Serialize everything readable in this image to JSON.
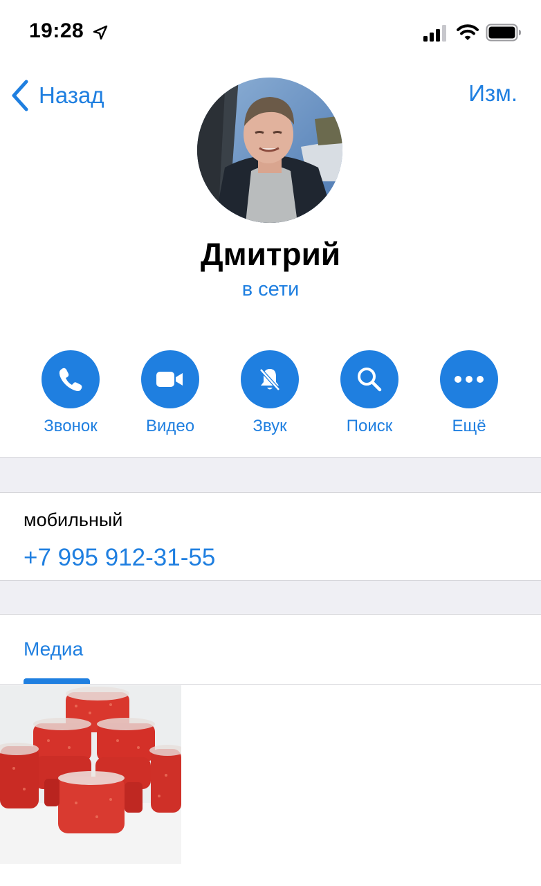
{
  "status_bar": {
    "time": "19:28"
  },
  "nav": {
    "back_label": "Назад",
    "edit_label": "Изм."
  },
  "profile": {
    "name": "Дмитрий",
    "status": "в сети"
  },
  "actions": [
    {
      "label": "Звонок",
      "icon": "phone-icon"
    },
    {
      "label": "Видео",
      "icon": "video-icon"
    },
    {
      "label": "Звук",
      "icon": "bell-muted-icon"
    },
    {
      "label": "Поиск",
      "icon": "search-icon"
    },
    {
      "label": "Ещё",
      "icon": "more-icon"
    }
  ],
  "phone": {
    "label": "мобильный",
    "number": "+7 995 912-31-55"
  },
  "media": {
    "tab_label": "Медиа"
  },
  "colors": {
    "accent": "#1f7fe0",
    "section_background": "#efeff4"
  }
}
